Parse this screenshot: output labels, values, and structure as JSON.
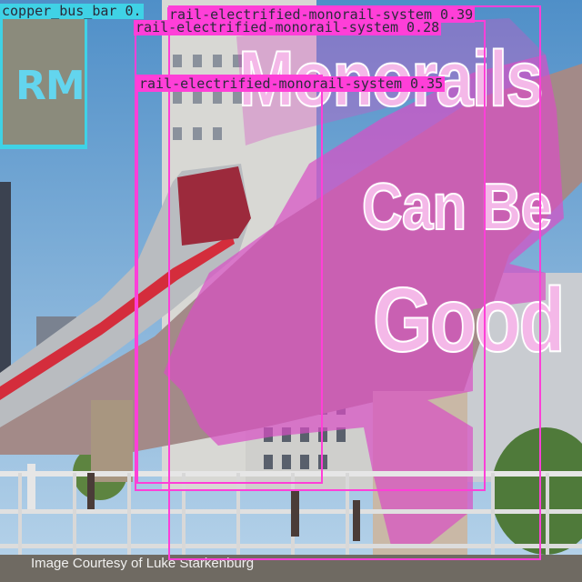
{
  "logo_text": "RM",
  "headline": {
    "line1": "Monorails",
    "line2": "Can Be",
    "line3": "Good"
  },
  "credit": "Image Courtesy of Luke Starkenburg",
  "detections": [
    {
      "label": "copper_bus_bar",
      "score": "0.",
      "color": "#3fd2e6"
    },
    {
      "label": "rail-electrified-monorail-system",
      "score": "0.39",
      "color": "#ff3fd8"
    },
    {
      "label": "rail-electrified-monorail-system",
      "score": "0.28",
      "color": "#ff3fd8"
    },
    {
      "label": "rail-electrified-monorail-system",
      "score": "0.35",
      "color": "#ff3fd8"
    }
  ],
  "colors": {
    "mask": "#d84fc4",
    "box": "#ff3fd8",
    "bus_bar": "#3fd2e6"
  }
}
